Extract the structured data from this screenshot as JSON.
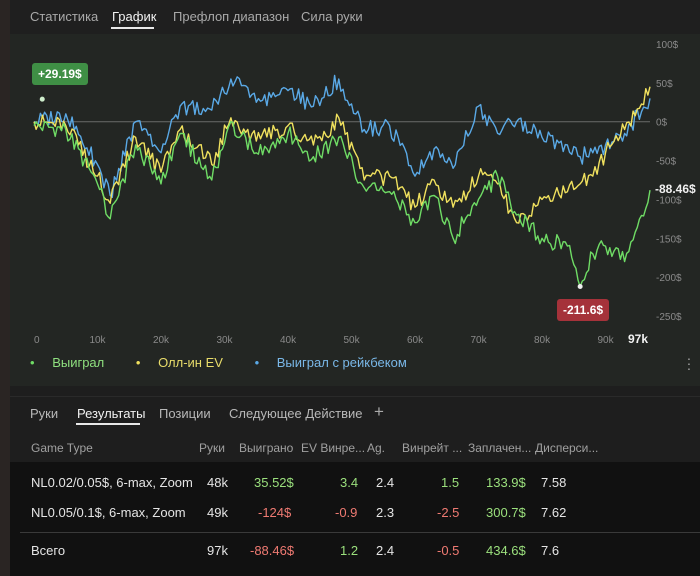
{
  "tabs": [
    "Статистика",
    "График",
    "Префлоп диапазон",
    "Сила руки"
  ],
  "active_tab": "График",
  "chart_data": {
    "type": "line",
    "x_ticks": [
      "0",
      "10k",
      "20k",
      "30k",
      "40k",
      "50k",
      "60k",
      "70k",
      "80k",
      "90k"
    ],
    "x_end_label": "97k",
    "y_ticks": [
      "100$",
      "50$",
      "0$",
      "-50$",
      "-100$",
      "-150$",
      "-200$",
      "-250$"
    ],
    "ylim": [
      -250,
      100
    ],
    "xlim": [
      0,
      97
    ],
    "max_label": "+29.19$",
    "min_label": "-211.6$",
    "last_label": "-88.46$",
    "series": [
      {
        "name": "Выиграл",
        "color": "#6fdc65",
        "x": [
          0,
          5,
          10,
          12,
          16,
          20,
          23,
          28,
          31,
          35,
          40,
          44,
          48,
          52,
          56,
          60,
          63,
          66,
          70,
          73,
          76,
          80,
          84,
          86,
          88,
          90,
          93,
          97
        ],
        "y": [
          -5,
          -10,
          -80,
          -125,
          -30,
          -80,
          -15,
          -75,
          0,
          -40,
          -15,
          -45,
          -20,
          -85,
          -90,
          -130,
          -95,
          -150,
          -100,
          -70,
          -120,
          -150,
          -160,
          -212,
          -170,
          -160,
          -180,
          -88
        ]
      },
      {
        "name": "Олл-ин EV",
        "color": "#f0e15e",
        "x": [
          0,
          5,
          10,
          12,
          16,
          20,
          23,
          28,
          31,
          35,
          40,
          44,
          48,
          52,
          56,
          60,
          63,
          66,
          70,
          73,
          76,
          80,
          84,
          86,
          88,
          90,
          93,
          97
        ],
        "y": [
          0,
          -5,
          -70,
          -105,
          -20,
          -65,
          -10,
          -55,
          5,
          -25,
          -5,
          -30,
          5,
          -75,
          -70,
          -110,
          -75,
          -110,
          -70,
          -80,
          -130,
          -100,
          -90,
          -80,
          -70,
          -40,
          -10,
          45
        ]
      },
      {
        "name": "Выиграл с рейкбеком",
        "color": "#5aa9e6",
        "x": [
          0,
          5,
          10,
          12,
          16,
          20,
          23,
          28,
          31,
          35,
          40,
          44,
          48,
          52,
          56,
          60,
          63,
          66,
          70,
          73,
          76,
          80,
          84,
          86,
          88,
          90,
          93,
          97
        ],
        "y": [
          0,
          10,
          -55,
          -95,
          0,
          -40,
          20,
          15,
          55,
          25,
          40,
          20,
          55,
          -10,
          -5,
          -70,
          -35,
          -60,
          20,
          -15,
          0,
          -20,
          -30,
          -45,
          -40,
          -30,
          -15,
          30
        ]
      }
    ]
  },
  "legend": [
    "Выиграл",
    "Олл-ин EV",
    "Выиграл с рейкбеком"
  ],
  "bottom_tabs": [
    "Руки",
    "Результаты",
    "Позиции",
    "Следующее Действие"
  ],
  "add_tab_symbol": "+",
  "table": {
    "headers": [
      "Game Type",
      "Руки",
      "Выиграно",
      "EV Винре...",
      "Ag.",
      "Винрейт ...",
      "Заплачен...",
      "Дисперси..."
    ],
    "rows": [
      {
        "game": "NL0.02/0.05$, 6-max, Zoom",
        "hands": "48k",
        "won": "35.52$",
        "ev": "3.4",
        "ag": "2.4",
        "wr": "1.5",
        "paid": "133.9$",
        "disp": "7.58"
      },
      {
        "game": "NL0.05/0.1$, 6-max, Zoom",
        "hands": "49k",
        "won": "-124$",
        "ev": "-0.9",
        "ag": "2.3",
        "wr": "-2.5",
        "paid": "300.7$",
        "disp": "7.62"
      }
    ],
    "total": {
      "game": "Всего",
      "hands": "97k",
      "won": "-88.46$",
      "ev": "1.2",
      "ag": "2.4",
      "wr": "-0.5",
      "paid": "434.6$",
      "disp": "7.6"
    }
  }
}
